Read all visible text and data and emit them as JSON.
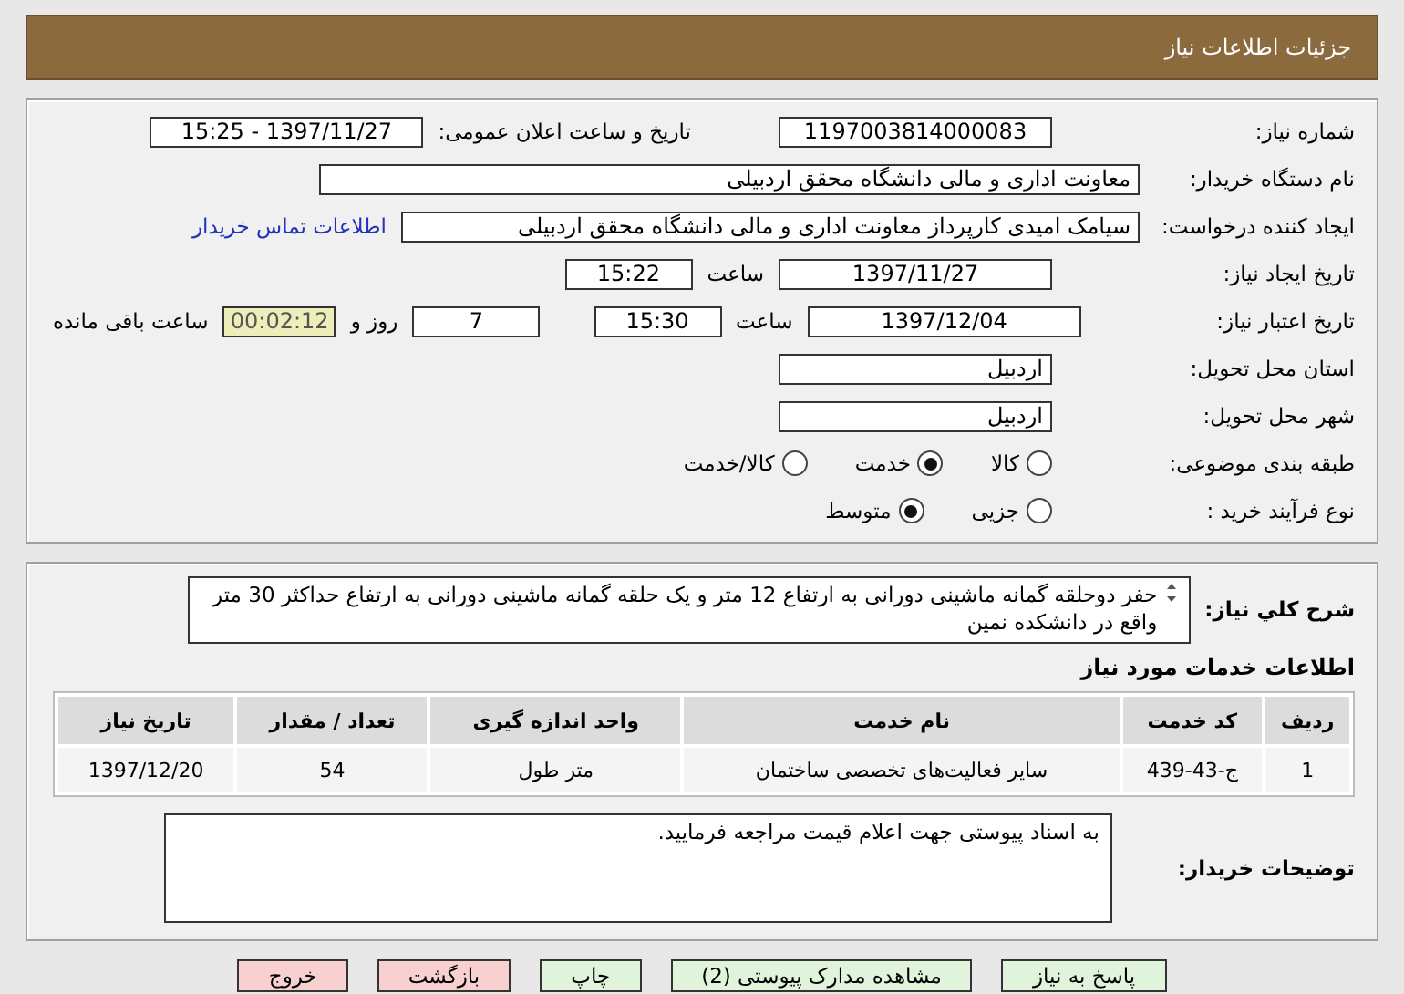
{
  "header": {
    "title": "جزئیات اطلاعات نیاز"
  },
  "need_number": {
    "label": "شماره نیاز:",
    "value": "1197003814000083"
  },
  "announce": {
    "label": "تاریخ و ساعت اعلان عمومی:",
    "value": "1397/11/27 - 15:25"
  },
  "buyer_org": {
    "label": "نام دستگاه خریدار:",
    "value": "معاونت اداری و مالی دانشگاه محقق اردبیلی"
  },
  "requester": {
    "label": "ایجاد کننده درخواست:",
    "value": "سیامک امیدی کارپرداز معاونت اداری و مالی دانشگاه محقق اردبیلی",
    "link": "اطلاعات تماس خریدار"
  },
  "created": {
    "label": "تاریخ ایجاد نیاز:",
    "date": "1397/11/27",
    "time_label": "ساعت",
    "time": "15:22"
  },
  "validity": {
    "label": "تاریخ اعتبار نیاز:",
    "date": "1397/12/04",
    "time_label": "ساعت",
    "time": "15:30",
    "days": "7",
    "days_label": "روز و",
    "remaining": "00:02:12",
    "remaining_label": "ساعت باقی مانده"
  },
  "province": {
    "label": "استان محل تحویل:",
    "value": "اردبیل"
  },
  "city": {
    "label": "شهر محل تحویل:",
    "value": "اردبیل"
  },
  "category": {
    "label": "طبقه بندی موضوعی:",
    "options": [
      {
        "label": "کالا",
        "selected": false
      },
      {
        "label": "خدمت",
        "selected": true
      },
      {
        "label": "کالا/خدمت",
        "selected": false
      }
    ]
  },
  "purchase_type": {
    "label": "نوع فرآیند خرید :",
    "options": [
      {
        "label": "جزیی",
        "selected": false
      },
      {
        "label": "متوسط",
        "selected": true
      }
    ]
  },
  "description": {
    "label": "شرح کلي نیاز:",
    "value": "حفر دوحلقه گمانه ماشینی دورانی به ارتفاع 12 متر و یک حلقه گمانه ماشینی دورانی به ارتفاع حداکثر 30 متر واقع در دانشکده نمین"
  },
  "services": {
    "title": "اطلاعات خدمات مورد نیاز",
    "columns": [
      "ردیف",
      "کد خدمت",
      "نام خدمت",
      "واحد اندازه گیری",
      "تعداد / مقدار",
      "تاریخ نیاز"
    ],
    "rows": [
      [
        "1",
        "ج-43-439",
        "سایر فعالیت‌های تخصصی ساختمان",
        "متر طول",
        "54",
        "1397/12/20"
      ]
    ]
  },
  "buyer_notes": {
    "label": "توضیحات خریدار:",
    "value": "به اسناد پیوستی جهت اعلام قیمت مراجعه فرمایید."
  },
  "buttons": [
    {
      "label": "پاسخ به نیاز",
      "kind": "action"
    },
    {
      "label": "مشاهده مدارک پیوستی (2)",
      "kind": "action"
    },
    {
      "label": "چاپ",
      "kind": "action"
    },
    {
      "label": "بازگشت",
      "kind": "exit"
    },
    {
      "label": "خروج",
      "kind": "exit"
    }
  ]
}
